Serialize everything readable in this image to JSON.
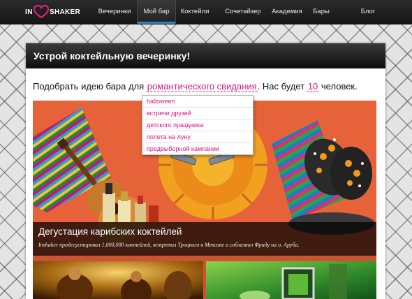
{
  "brand": {
    "logo_in": "IN",
    "logo_shaker": "SHAKER",
    "accent": "#d6197e",
    "nav_accent": "#2a86c8"
  },
  "nav": {
    "items": [
      {
        "label": "Вечеринки",
        "active": false
      },
      {
        "label": "Мой бар",
        "active": true
      },
      {
        "label": "Коктейли",
        "active": false
      },
      {
        "label": "Сочетайзер",
        "active": false
      },
      {
        "label": "Академия",
        "active": false
      },
      {
        "label": "Бары",
        "active": false
      },
      {
        "label": "Блог",
        "active": false
      }
    ]
  },
  "panel": {
    "title": "Устрой коктейльную вечеринку!",
    "sentence": {
      "prefix": "Подобрать идею бара для",
      "occasion": "романтического свидания",
      "middle": ". Нас будет",
      "count": "10",
      "suffix": "человек."
    },
    "dropdown": {
      "options": [
        "halloween",
        "встречи друзей",
        "детского праздника",
        "полета на луну",
        "предвыборной кампании"
      ]
    },
    "hero": {
      "title": "Дегустация карибских коктейлей",
      "description": "Inshaker продегустировал 1,000,000 коктейлей, встретил Троцкого в Мексике и соблазнил Фриду на о. Аруба."
    }
  }
}
